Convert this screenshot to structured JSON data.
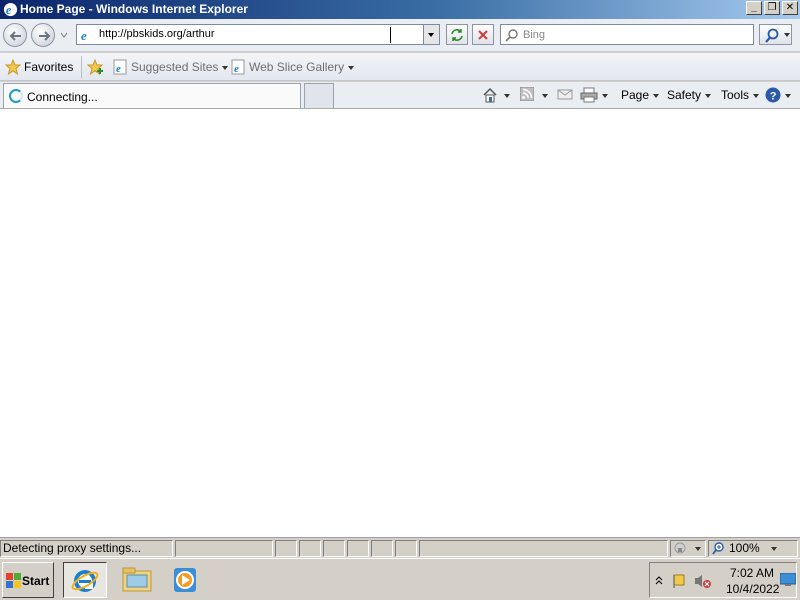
{
  "window": {
    "title": "Home Page - Windows Internet Explorer",
    "buttons": {
      "minimize": "_",
      "restore": "❐",
      "close": "✕"
    }
  },
  "navigation": {
    "back_icon": "back-arrow-icon",
    "forward_icon": "forward-arrow-icon",
    "address": {
      "value": "http://pbskids.org/arthur"
    },
    "refresh_icon": "refresh-icon",
    "stop_icon": "stop-icon",
    "search": {
      "placeholder": "Bing"
    },
    "search_icon": "search-icon"
  },
  "favorites_bar": {
    "favorites_label": "Favorites",
    "items": [
      {
        "label": "Suggested Sites"
      },
      {
        "label": "Web Slice Gallery"
      }
    ]
  },
  "tabs": [
    {
      "label": "Connecting..."
    }
  ],
  "command_bar": {
    "page_label": "Page",
    "safety_label": "Safety",
    "tools_label": "Tools"
  },
  "status_bar": {
    "message": "Detecting proxy settings...",
    "zoom": "100%"
  },
  "taskbar": {
    "start_label": "Start",
    "apps": [
      "internet-explorer",
      "windows-explorer",
      "windows-media-player"
    ],
    "clock": {
      "time": "7:02 AM",
      "date": "10/4/2022"
    }
  },
  "colors": {
    "titlebar_start": "#0a246a",
    "titlebar_end": "#a6caf0",
    "chrome": "#d4d0c8",
    "ie_blue": "#1b7fd1"
  }
}
